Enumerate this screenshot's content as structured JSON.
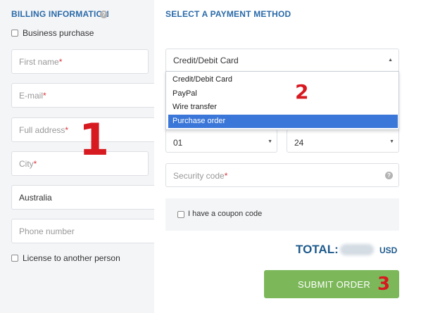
{
  "billing": {
    "title": "BILLING INFORMATION",
    "help_icon": "question-circle-icon",
    "business_checkbox_label": "Business purchase",
    "fields": {
      "first_name": "First name",
      "email": "E-mail",
      "full_address": "Full address",
      "city": "City",
      "country_value": "Australia",
      "phone": "Phone number"
    },
    "required_mark": "*",
    "license_checkbox_label": "License to another person"
  },
  "payment": {
    "title": "SELECT A PAYMENT METHOD",
    "method_selected": "Credit/Debit Card",
    "method_options": [
      "Credit/Debit Card",
      "PayPal",
      "Wire transfer",
      "Purchase order"
    ],
    "highlighted_option": "Purchase order",
    "expiry_month": "01",
    "expiry_year": "24",
    "security_code_placeholder": "Security code",
    "security_help_icon": "question-circle-icon",
    "coupon_checkbox_label": "I have a coupon code"
  },
  "order": {
    "total_label": "TOTAL:",
    "currency": "USD",
    "submit_label": "SUBMIT ORDER"
  },
  "annotations": {
    "marker_1": "1",
    "marker_2": "2",
    "marker_3": "3"
  },
  "colors": {
    "accent_blue": "#2a6aa8",
    "total_blue": "#1e5a8c",
    "submit_green": "#7cb85a",
    "highlight_blue": "#3b77d8",
    "required_red": "#d9363e",
    "marker_red": "#d71920"
  }
}
